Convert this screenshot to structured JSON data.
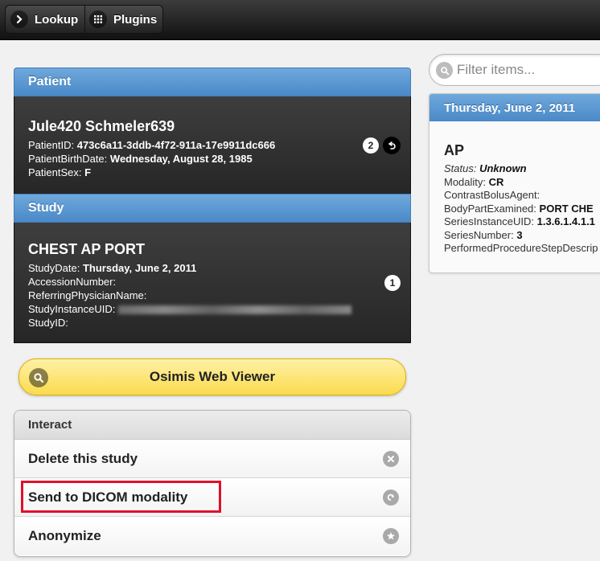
{
  "header": {
    "lookup_label": "Lookup",
    "plugins_label": "Plugins"
  },
  "patient": {
    "section_label": "Patient",
    "name": "Jule420 Schmeler639",
    "fields": [
      {
        "label": "PatientID:",
        "value": "473c6a11-3ddb-4f72-911a-17e9911dc666"
      },
      {
        "label": "PatientBirthDate:",
        "value": "Wednesday, August 28, 1985"
      },
      {
        "label": "PatientSex:",
        "value": "F"
      }
    ],
    "count": "2"
  },
  "study": {
    "section_label": "Study",
    "name": "CHEST AP PORT",
    "fields": [
      {
        "label": "StudyDate:",
        "value": "Thursday, June 2, 2011"
      },
      {
        "label": "AccessionNumber:",
        "value": ""
      },
      {
        "label": "ReferringPhysicianName:",
        "value": ""
      },
      {
        "label": "StudyInstanceUID:",
        "value": ""
      },
      {
        "label": "StudyID:",
        "value": ""
      }
    ],
    "count": "1"
  },
  "viewer_button": {
    "label": "Osimis Web Viewer"
  },
  "interact": {
    "header": "Interact",
    "items": [
      {
        "label": "Delete this study"
      },
      {
        "label": "Send to DICOM modality"
      },
      {
        "label": "Anonymize"
      }
    ]
  },
  "filter": {
    "placeholder": "Filter items..."
  },
  "series": {
    "date_header": "Thursday, June 2, 2011",
    "title": "AP",
    "status_label": "Status:",
    "status_value": "Unknown",
    "fields": [
      {
        "label": "Modality:",
        "value": "CR"
      },
      {
        "label": "ContrastBolusAgent:",
        "value": ""
      },
      {
        "label": "BodyPartExamined:",
        "value": "PORT CHE"
      },
      {
        "label": "SeriesInstanceUID:",
        "value": "1.3.6.1.4.1.1"
      },
      {
        "label": "SeriesNumber:",
        "value": "3"
      },
      {
        "label": "PerformedProcedureStepDescrip",
        "value": ""
      }
    ]
  }
}
